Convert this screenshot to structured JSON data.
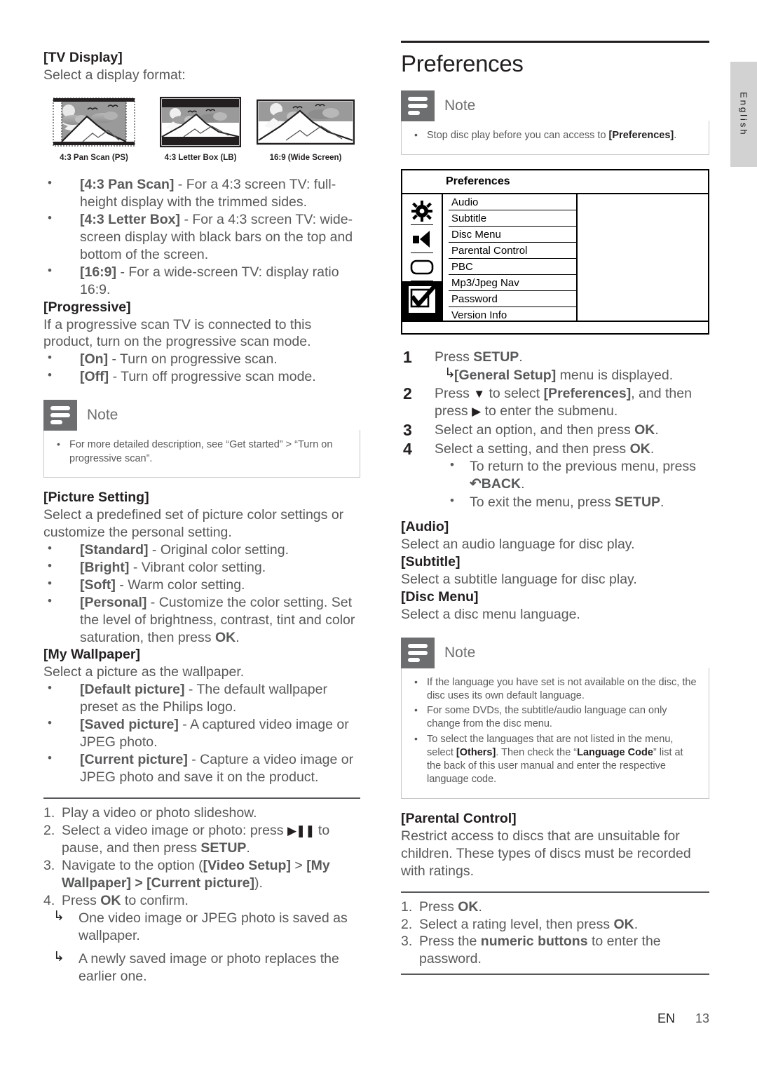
{
  "page": {
    "language_tab": "English",
    "footer_lang": "EN",
    "footer_page": "13"
  },
  "left_column": {
    "tv_display": {
      "heading": "[TV Display]",
      "intro": "Select a display format:",
      "thumbnails": [
        {
          "caption": "4:3 Pan Scan (PS)",
          "mode": "pan-scan"
        },
        {
          "caption": "4:3 Letter Box (LB)",
          "mode": "letter-box"
        },
        {
          "caption": "16:9 (Wide Screen)",
          "mode": "wide-screen"
        }
      ],
      "options": [
        {
          "term": "[4:3 Pan Scan]",
          "desc": " - For a 4:3 screen TV: full-height display with the trimmed sides."
        },
        {
          "term": "[4:3 Letter Box]",
          "desc": " - For a 4:3 screen TV: wide-screen display with black bars on the top and bottom of the screen."
        },
        {
          "term": "[16:9]",
          "desc": " - For a wide-screen TV: display ratio 16:9."
        }
      ]
    },
    "progressive": {
      "heading": "[Progressive]",
      "intro": "If a progressive scan TV is connected to this product, turn on the progressive scan mode.",
      "options": [
        {
          "term": "[On]",
          "desc": " - Turn on progressive scan."
        },
        {
          "term": "[Off]",
          "desc": " - Turn off progressive scan mode."
        }
      ]
    },
    "note1": {
      "title": "Note",
      "icon": "note-lines-icon",
      "items": [
        "For more detailed description, see “Get started” > “Turn on progressive scan”."
      ]
    },
    "picture_setting": {
      "heading": "[Picture Setting]",
      "intro": "Select a predefined set of picture color settings or customize the personal setting.",
      "options": [
        {
          "term": "[Standard]",
          "desc": " - Original color setting."
        },
        {
          "term": "[Bright]",
          "desc": " - Vibrant color setting."
        },
        {
          "term": "[Soft]",
          "desc": " - Warm color setting."
        },
        {
          "term": "[Personal]",
          "desc": " - Customize the color setting. Set the level of brightness, contrast, tint and color saturation, then press ",
          "desc_bold": "OK",
          "desc_tail": "."
        }
      ]
    },
    "my_wallpaper": {
      "heading": "[My Wallpaper]",
      "intro": "Select a picture as the wallpaper.",
      "options": [
        {
          "term": "[Default picture]",
          "desc": " - The default wallpaper preset as the Philips logo."
        },
        {
          "term": "[Saved picture]",
          "desc": " - A captured video image or JPEG photo."
        },
        {
          "term": "[Current picture]",
          "desc": " - Capture a video image or JPEG photo and save it on the product."
        }
      ]
    },
    "wallpaper_steps": {
      "items": [
        {
          "text_a": "Play a video or photo slideshow."
        },
        {
          "text_a": "Select a video image or photo: press ",
          "icon": "play-pause-icon",
          "text_b": " to pause, and then press ",
          "bold": "SETUP",
          "text_c": "."
        },
        {
          "text_a": "Navigate to the option (",
          "bold": "[Video Setup]",
          "text_b": " > ",
          "bold2": "[My Wallpaper] > [Current picture]",
          "text_c": ")."
        },
        {
          "text_a": "Press ",
          "bold": "OK",
          "text_b": " to confirm."
        }
      ],
      "results": [
        "One video image or JPEG photo is saved as wallpaper.",
        "A newly saved image or photo replaces the earlier one."
      ]
    }
  },
  "right_column": {
    "title": "Preferences",
    "note1": {
      "title": "Note",
      "icon": "note-lines-icon",
      "items_a": "Stop disc play before you can access to ",
      "items_bold": "[Preferences]",
      "items_b": "."
    },
    "osd": {
      "title": "Preferences",
      "icons": [
        {
          "name": "gear-icon"
        },
        {
          "name": "speaker-icon"
        },
        {
          "name": "rounded-rect-icon"
        },
        {
          "name": "checkbox-check-icon",
          "selected": true
        }
      ],
      "rows": [
        "Audio",
        "Subtitle",
        "Disc Menu",
        "Parental Control",
        "PBC",
        "Mp3/Jpeg Nav",
        "Password",
        "Version Info"
      ]
    },
    "steps": [
      {
        "text_a": "Press ",
        "bold": "SETUP",
        "text_b": "."
      },
      {
        "text_a": "Press ",
        "glyph": "▼",
        "text_b": " to select ",
        "bold": "[Preferences]",
        "text_c": ", and then press ",
        "glyph2": "▶",
        "text_d": " to enter the submenu."
      },
      {
        "text_a": "Select an option, and then press ",
        "bold": "OK",
        "text_b": "."
      },
      {
        "text_a": "Select a setting, and then press ",
        "bold": "OK",
        "text_b": "."
      }
    ],
    "step1_result": {
      "bold": "[General Setup]",
      "text": " menu is displayed."
    },
    "step4_bullets": [
      {
        "text_a": "To return to the previous menu, press ",
        "glyph": "↶",
        "bold": "BACK",
        "text_b": "."
      },
      {
        "text_a": "To exit the menu, press ",
        "bold": "SETUP",
        "text_b": "."
      }
    ],
    "audio": {
      "heading": "[Audio]",
      "body": "Select an audio language for disc play."
    },
    "subtitle": {
      "heading": "[Subtitle]",
      "body": "Select a subtitle language for disc play."
    },
    "disc_menu": {
      "heading": "[Disc Menu]",
      "body": "Select a disc menu language."
    },
    "note2": {
      "title": "Note",
      "icon": "note-lines-icon",
      "items": [
        {
          "a": "If the language you have set is not available on the disc, the disc uses its own default language."
        },
        {
          "a": "For some DVDs, the subtitle/audio language can only change from the disc menu."
        },
        {
          "a": "To select the languages that are not listed in the menu, select ",
          "b1": "[Others]",
          "c": ". Then check the “",
          "b2": "Language Code",
          "d": "” list at the back of this user manual and enter the respective language code."
        }
      ]
    },
    "parental_control": {
      "heading": "[Parental Control]",
      "body": "Restrict access to discs that are unsuitable for children. These types of discs must be recorded with ratings.",
      "steps": [
        {
          "text_a": "Press ",
          "bold": "OK",
          "text_b": "."
        },
        {
          "text_a": "Select a rating level, then press ",
          "bold": "OK",
          "text_b": "."
        },
        {
          "text_a": "Press the ",
          "bold": "numeric buttons",
          "text_b": " to enter the password."
        }
      ]
    }
  }
}
